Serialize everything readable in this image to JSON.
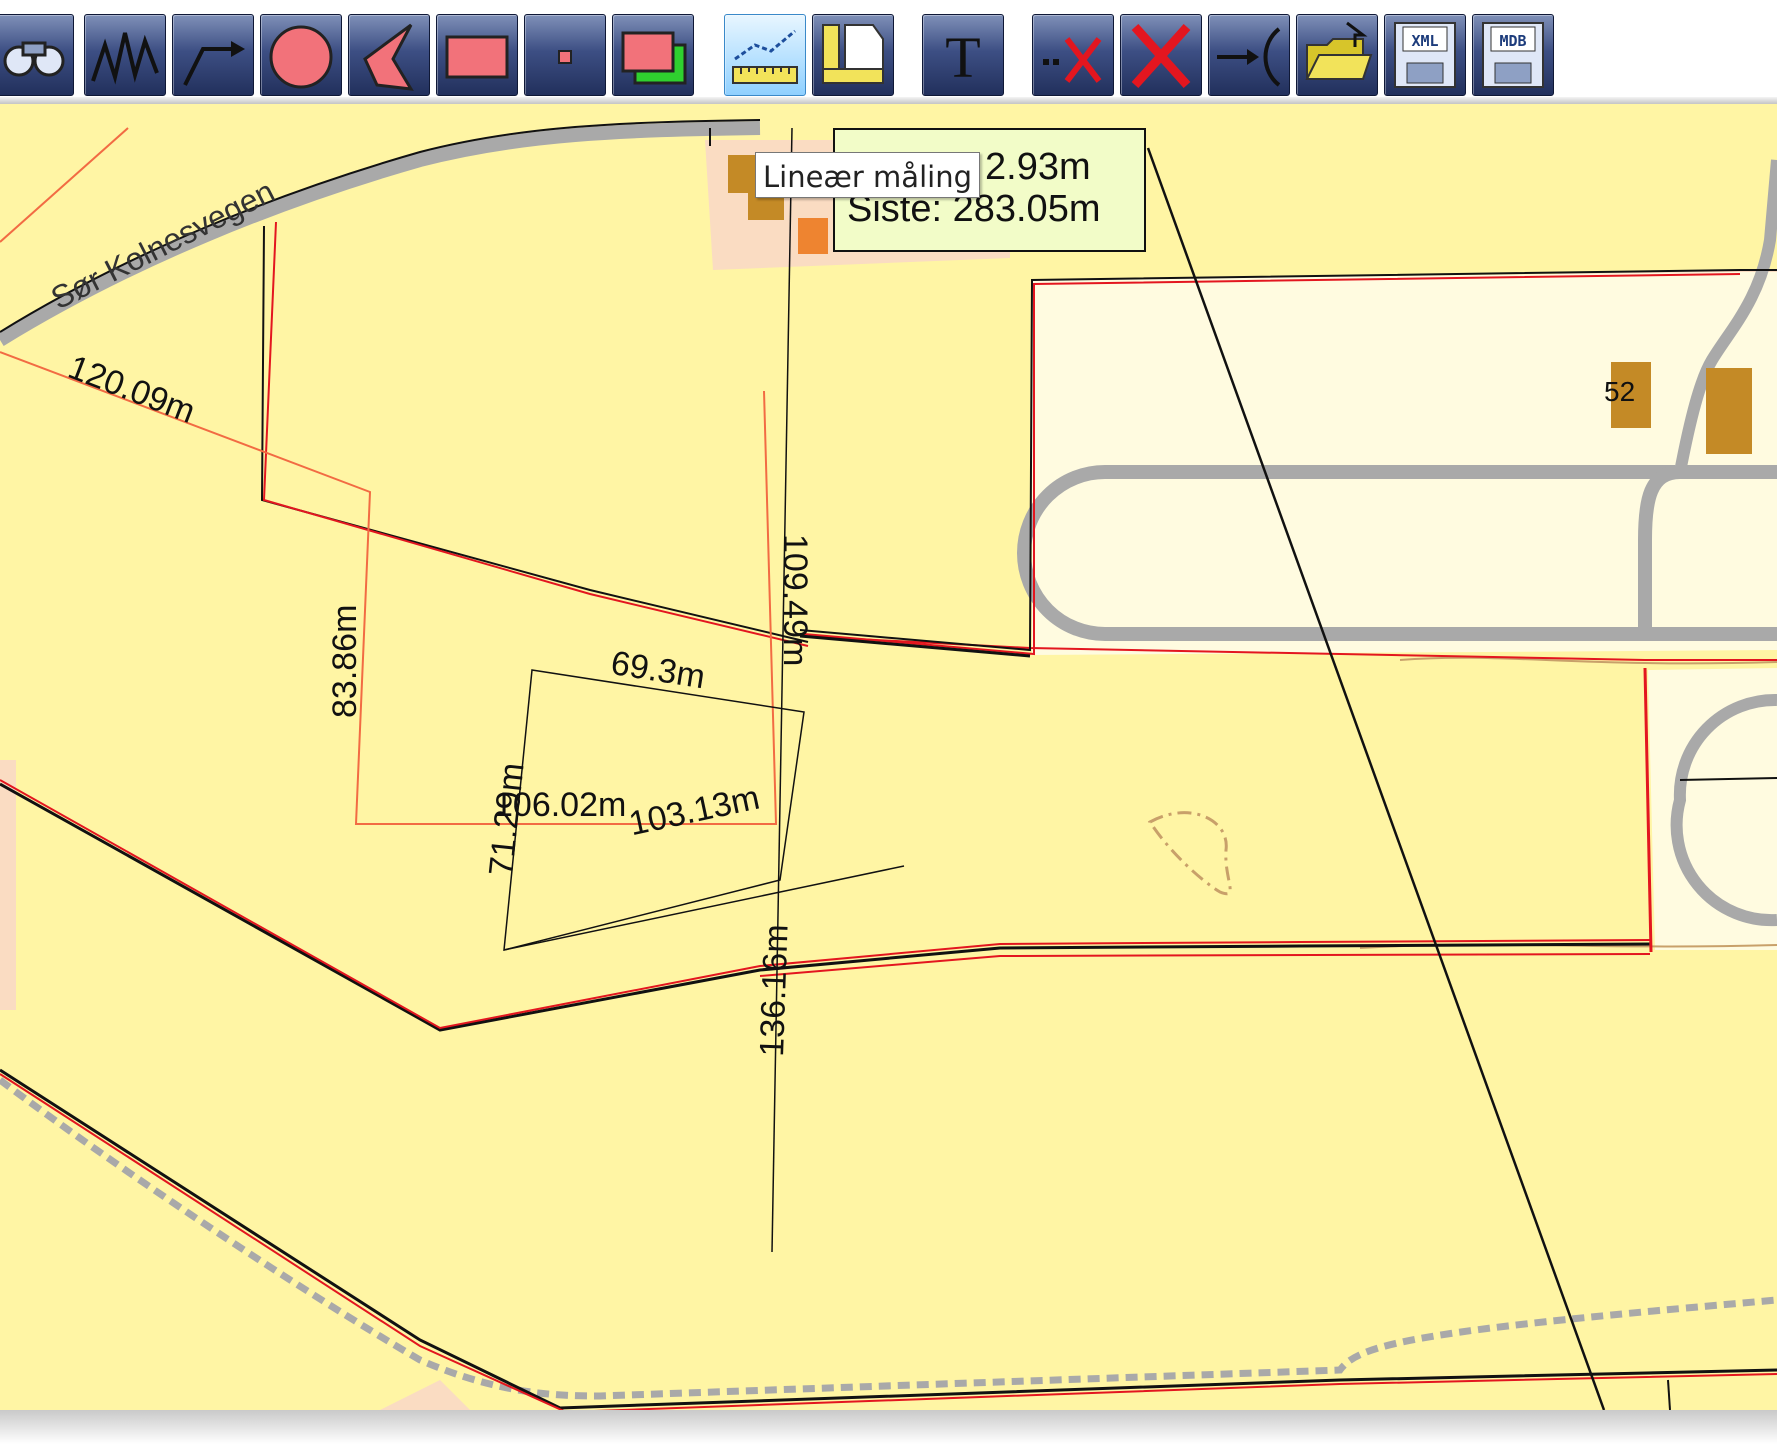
{
  "toolbar": {
    "buttons": [
      {
        "id": "zoom",
        "icon": "binoculars-icon",
        "active": false
      },
      {
        "id": "line",
        "icon": "zigzag-line-icon",
        "active": false
      },
      {
        "id": "arrow",
        "icon": "arrow-line-icon",
        "active": false
      },
      {
        "id": "circle",
        "icon": "circle-icon",
        "active": false
      },
      {
        "id": "polygon",
        "icon": "polygon-icon",
        "active": false
      },
      {
        "id": "rectangle",
        "icon": "rectangle-icon",
        "active": false
      },
      {
        "id": "point",
        "icon": "point-icon",
        "active": false
      },
      {
        "id": "layers",
        "icon": "layered-rectangles-icon",
        "active": false
      },
      {
        "id": "linear-measure",
        "icon": "linear-measure-icon",
        "active": true
      },
      {
        "id": "area-measure",
        "icon": "area-measure-icon",
        "active": false
      },
      {
        "id": "text",
        "icon": "text-icon",
        "active": false
      },
      {
        "id": "delete-point",
        "icon": "delete-point-icon",
        "active": false
      },
      {
        "id": "delete",
        "icon": "delete-x-icon",
        "active": false
      },
      {
        "id": "connect",
        "icon": "connect-icon",
        "active": false
      },
      {
        "id": "open",
        "icon": "open-folder-icon",
        "active": false
      },
      {
        "id": "save-xml",
        "icon": "save-xml-icon",
        "label": "XML",
        "active": false
      },
      {
        "id": "save-mdb",
        "icon": "save-mdb-icon",
        "label": "MDB",
        "active": false
      }
    ],
    "text_button_glyph": "T"
  },
  "tooltip": {
    "text": "Lineær måling"
  },
  "readout": {
    "total": "2.93m",
    "last": "Siste: 283.05m"
  },
  "map": {
    "road_name": "Sør Kolnesvegen",
    "house_number": "52",
    "measurements": [
      "120.09m",
      "83.86m",
      "109.49m",
      "69.3m",
      "71.29m",
      "106.02m",
      "103.13m",
      "136.16m"
    ]
  },
  "colors": {
    "land": "#fff5a4",
    "building_area": "#fadcc2",
    "building": "#c48a26",
    "road": "#a9a9a9",
    "property_line": "#e3161f",
    "measure_line": "#f26b43",
    "tool_active": "#8fd0ff",
    "readout_bg": "#f2fcc8"
  }
}
